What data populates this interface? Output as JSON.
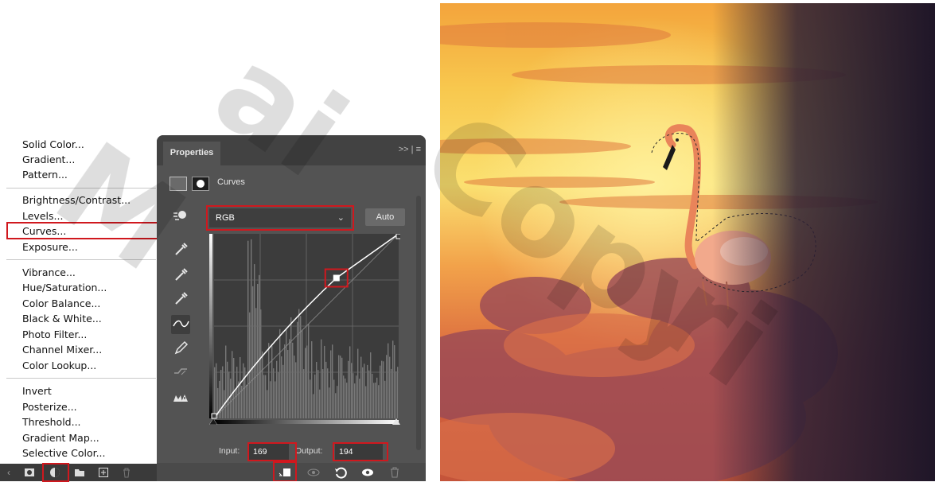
{
  "menu": {
    "groups": [
      [
        "Solid Color...",
        "Gradient...",
        "Pattern..."
      ],
      [
        "Brightness/Contrast...",
        "Levels...",
        "Curves...",
        "Exposure..."
      ],
      [
        "Vibrance...",
        "Hue/Saturation...",
        "Color Balance...",
        "Black & White...",
        "Photo Filter...",
        "Channel Mixer...",
        "Color Lookup..."
      ],
      [
        "Invert",
        "Posterize...",
        "Threshold...",
        "Gradient Map...",
        "Selective Color..."
      ]
    ],
    "highlighted": "Curves..."
  },
  "panel": {
    "tab": "Properties",
    "header_right": ">> | ≡",
    "adjustment_label": "Curves",
    "channel": "RGB",
    "auto_label": "Auto",
    "input_label": "Input:",
    "input_value": "169",
    "output_label": "Output:",
    "output_value": "194"
  },
  "curve": {
    "point_input": 169,
    "point_output": 194,
    "range": [
      0,
      255
    ]
  },
  "colors": {
    "highlight": "#d0181e",
    "panel_bg": "#535353",
    "graph_bg": "#3c3c3c"
  },
  "icons": {
    "left_tools": [
      "target-adjust-icon",
      "black-eyedropper-icon",
      "gray-eyedropper-icon",
      "white-eyedropper-icon",
      "curve-edit-icon",
      "pencil-icon",
      "smooth-icon",
      "clipping-warning-icon"
    ],
    "panel_footer": [
      "clip-to-layer-icon",
      "view-previous-icon",
      "reset-icon",
      "visibility-eye-icon",
      "trash-icon"
    ],
    "layers_bar": [
      "layer-mask-icon",
      "adjustment-layer-icon",
      "folder-icon",
      "new-layer-icon",
      "trash-icon"
    ]
  }
}
